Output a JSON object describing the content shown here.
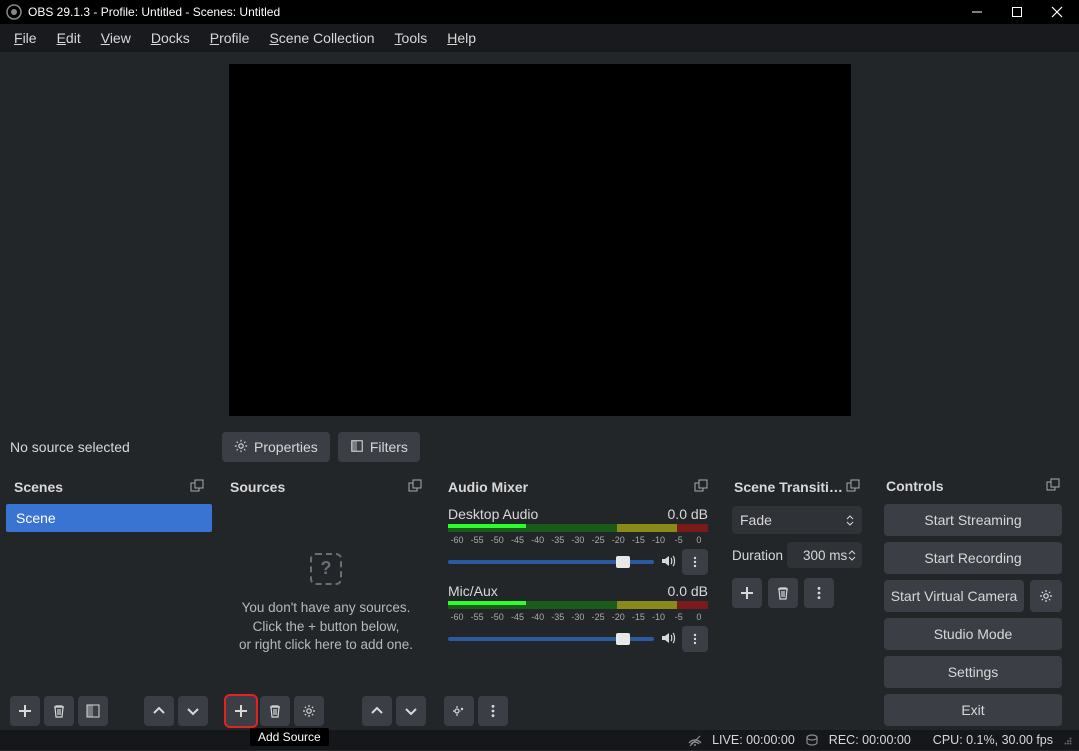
{
  "window": {
    "title": "OBS 29.1.3 - Profile: Untitled - Scenes: Untitled"
  },
  "menu": {
    "file": "File",
    "edit": "Edit",
    "view": "View",
    "docks": "Docks",
    "profile": "Profile",
    "scene_collection": "Scene Collection",
    "tools": "Tools",
    "help": "Help"
  },
  "under_toolbar": {
    "no_source": "No source selected",
    "properties": "Properties",
    "filters": "Filters"
  },
  "scenes": {
    "title": "Scenes",
    "items": [
      "Scene"
    ]
  },
  "sources": {
    "title": "Sources",
    "empty_line1": "You don't have any sources.",
    "empty_line2": "Click the + button below,",
    "empty_line3": "or right click here to add one.",
    "tooltip": "Add Source"
  },
  "mixer": {
    "title": "Audio Mixer",
    "channels": [
      {
        "name": "Desktop Audio",
        "db": "0.0 dB"
      },
      {
        "name": "Mic/Aux",
        "db": "0.0 dB"
      }
    ],
    "ticks": [
      "-60",
      "-55",
      "-50",
      "-45",
      "-40",
      "-35",
      "-30",
      "-25",
      "-20",
      "-15",
      "-10",
      "-5",
      "0"
    ]
  },
  "transitions": {
    "title": "Scene Transiti…",
    "selected": "Fade",
    "duration_label": "Duration",
    "duration_value": "300 ms"
  },
  "controls": {
    "title": "Controls",
    "start_streaming": "Start Streaming",
    "start_recording": "Start Recording",
    "virtual_camera": "Start Virtual Camera",
    "studio_mode": "Studio Mode",
    "settings": "Settings",
    "exit": "Exit"
  },
  "status": {
    "live": "LIVE: 00:00:00",
    "rec": "REC: 00:00:00",
    "cpu": "CPU: 0.1%, 30.00 fps"
  }
}
